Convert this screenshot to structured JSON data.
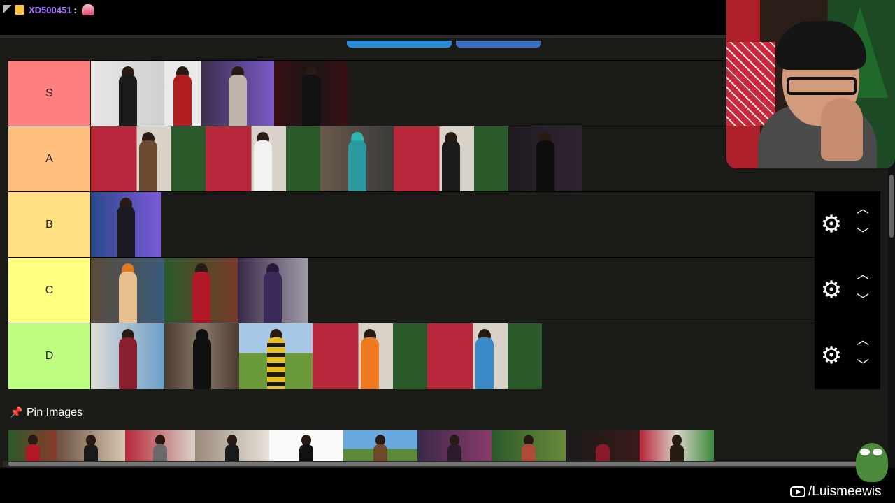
{
  "chat": {
    "username": "XD500451",
    "separator": ":",
    "badges": [
      "sword-badge-icon",
      "crown-badge-icon"
    ],
    "emote": "cake-emote-icon",
    "username_color": "#a970ff"
  },
  "tiers": [
    {
      "label": "S",
      "color": "#ff7f7f",
      "image_count": 4
    },
    {
      "label": "A",
      "color": "#ffbf7f",
      "image_count": 5
    },
    {
      "label": "B",
      "color": "#ffdf7f",
      "image_count": 1
    },
    {
      "label": "C",
      "color": "#ffff7f",
      "image_count": 3
    },
    {
      "label": "D",
      "color": "#bfff7f",
      "image_count": 5
    }
  ],
  "controls": {
    "settings_icon": "gear-icon",
    "move_up_icon": "chevron-up-icon",
    "move_down_icon": "chevron-down-icon"
  },
  "pin_section": {
    "title": "Pin Images",
    "icon": "pushpin-icon",
    "image_count": 10
  },
  "watermark": {
    "text": "/Luismeewis",
    "icon": "youtube-icon"
  },
  "colors": {
    "top_button_primary": "#2a8ad8",
    "top_button_secondary": "#3a6fc0",
    "panel_bg": "#1a1a17"
  }
}
